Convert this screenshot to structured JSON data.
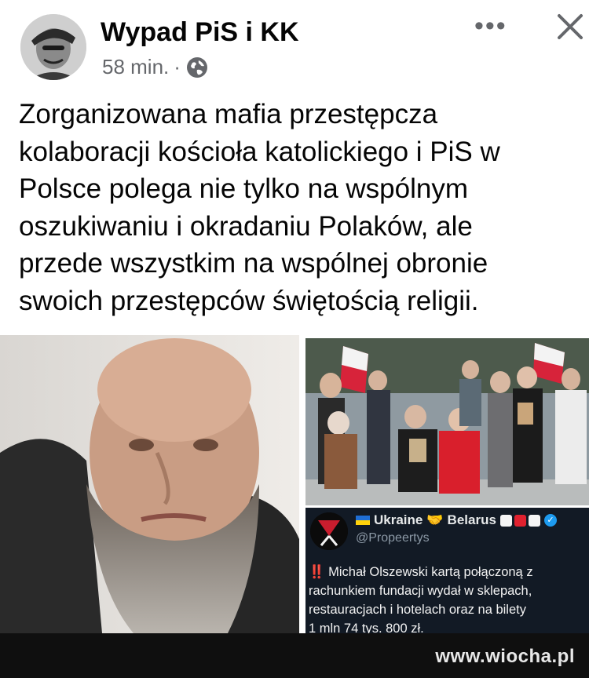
{
  "post": {
    "page_name": "Wypad PiS i KK",
    "time": "58 min.",
    "separator": "·",
    "privacy_icon": "globe-icon",
    "text": "Zorganizowana mafia przestępcza\nkolaboracji kościoła katolickiego i PiS w\nPolsce polega nie tylko na wspólnym\noszukiwaniu i okradaniu Polaków, ale\nprzede wszystkim na wspólnej obronie\nswoich przestępców świętością religii."
  },
  "tweet": {
    "name_part1": "Ukraine",
    "name_part2": "Belarus",
    "handle": "@Propeertys",
    "alert": "‼️",
    "body": "Michał Olszewski kartą połączoną z\nrachunkiem fundacji wydał w sklepach,\nrestauracjach i hotelach oraz na bilety\n1 mln 74 tys. 800 zł."
  },
  "watermark": "www.wiocha.pl",
  "colors": {
    "text": "#050505",
    "meta": "#65676b",
    "tweet_bg": "#121a25",
    "footer_bg": "#0f0f0f"
  }
}
